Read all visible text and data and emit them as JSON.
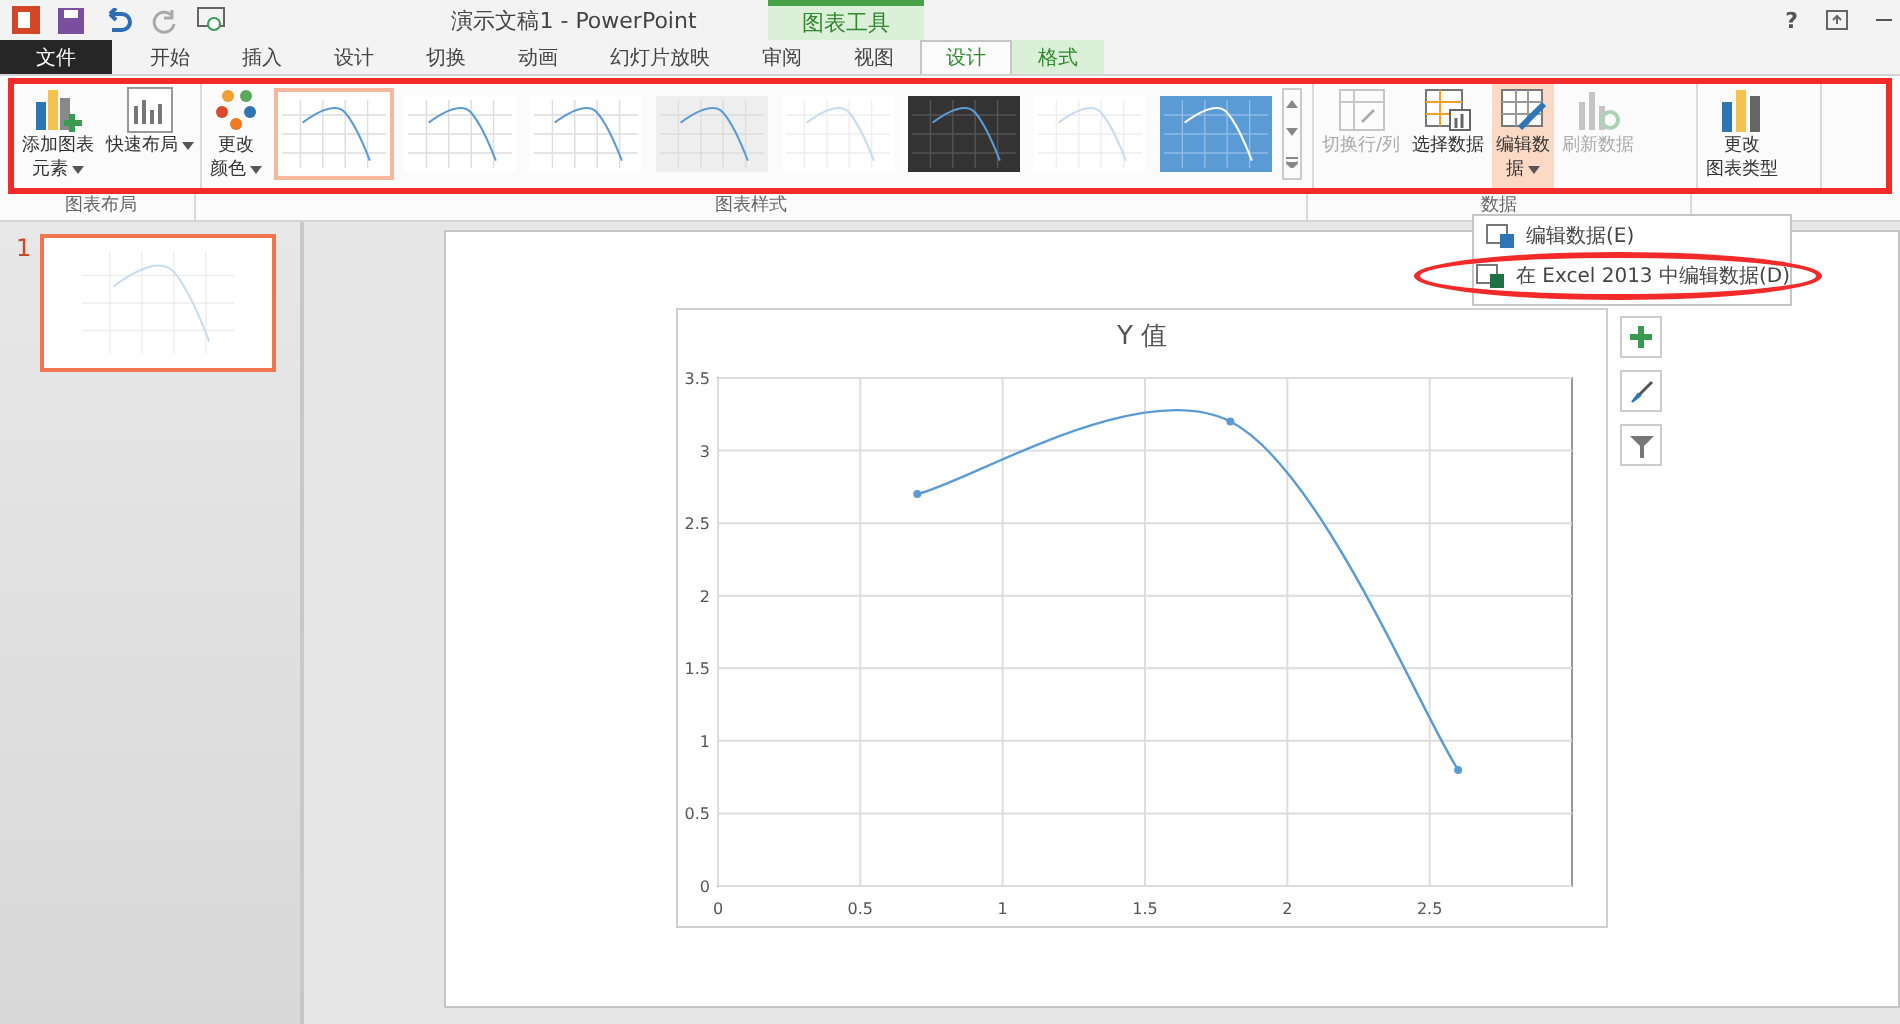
{
  "window": {
    "title": "演示文稿1 - PowerPoint",
    "context_title": "图表工具",
    "help": "?"
  },
  "tabs": [
    {
      "label": "文件",
      "kind": "file",
      "selected": false
    },
    {
      "label": "开始",
      "kind": "normal",
      "selected": false
    },
    {
      "label": "插入",
      "kind": "normal",
      "selected": false
    },
    {
      "label": "设计",
      "kind": "normal",
      "selected": false
    },
    {
      "label": "切换",
      "kind": "normal",
      "selected": false
    },
    {
      "label": "动画",
      "kind": "normal",
      "selected": false
    },
    {
      "label": "幻灯片放映",
      "kind": "normal",
      "selected": false
    },
    {
      "label": "审阅",
      "kind": "normal",
      "selected": false
    },
    {
      "label": "视图",
      "kind": "normal",
      "selected": false
    },
    {
      "label": "设计",
      "kind": "context",
      "selected": true
    },
    {
      "label": "格式",
      "kind": "context",
      "selected": false
    }
  ],
  "ribbon": {
    "groups": [
      {
        "label": "图表布局",
        "buttons": [
          {
            "lines": [
              "添加图表",
              "元素"
            ],
            "disabled": false,
            "dropdown": true,
            "selected": false
          },
          {
            "lines": [
              "快速布局"
            ],
            "disabled": false,
            "dropdown": true,
            "selected": false
          }
        ]
      },
      {
        "label": "图表样式",
        "buttons": [
          {
            "lines": [
              "更改",
              "颜色"
            ],
            "disabled": false,
            "dropdown": true,
            "selected": false
          }
        ],
        "styles": [
          {
            "kind": "plain",
            "selected": true
          },
          {
            "kind": "plain",
            "selected": false
          },
          {
            "kind": "plain",
            "selected": false
          },
          {
            "kind": "grey",
            "selected": false
          },
          {
            "kind": "faint",
            "selected": false
          },
          {
            "kind": "dark",
            "selected": false
          },
          {
            "kind": "faint",
            "selected": false
          },
          {
            "kind": "blue",
            "selected": false
          }
        ]
      },
      {
        "label": "数据",
        "buttons": [
          {
            "lines": [
              "切换行/列"
            ],
            "disabled": true,
            "dropdown": false,
            "selected": false
          },
          {
            "lines": [
              "选择数据"
            ],
            "disabled": false,
            "dropdown": false,
            "selected": false
          },
          {
            "lines": [
              "编辑数",
              "据"
            ],
            "disabled": false,
            "dropdown": true,
            "selected": true
          },
          {
            "lines": [
              "刷新数据"
            ],
            "disabled": true,
            "dropdown": false,
            "selected": false
          }
        ]
      },
      {
        "buttons": [
          {
            "lines": [
              "更改",
              "图表类型"
            ],
            "disabled": false,
            "dropdown": false,
            "selected": false
          }
        ]
      }
    ]
  },
  "dropdown_menu": {
    "items": [
      {
        "label": "编辑数据(E)",
        "circled": false
      },
      {
        "label": "在 Excel 2013 中编辑数据(D)",
        "circled": true
      }
    ]
  },
  "slides": [
    {
      "number": "1",
      "selected": true
    }
  ],
  "chart": {
    "chart_data": {
      "type": "line",
      "title": "Y 值",
      "grid": true,
      "x": [
        0.7,
        1.8,
        2.6
      ],
      "series": [
        {
          "color": "#5b9bd5",
          "marker": true,
          "values": [
            2.7,
            3.2,
            0.8
          ]
        }
      ],
      "xlim": [
        0,
        3
      ],
      "ylim": [
        0,
        3.5
      ],
      "xticks": [
        0,
        0.5,
        1,
        1.5,
        2,
        2.5
      ],
      "yticks": [
        0,
        0.5,
        1,
        1.5,
        2,
        2.5,
        3,
        3.5
      ]
    }
  }
}
